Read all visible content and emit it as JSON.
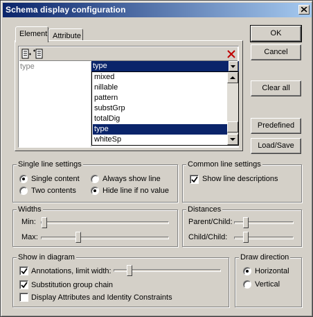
{
  "window": {
    "title": "Schema display configuration"
  },
  "tabs": [
    {
      "label": "Element"
    },
    {
      "label": "Attribute"
    }
  ],
  "list": {
    "row_label": "type",
    "combo_value": "type",
    "dropdown_items": [
      "mixed",
      "nillable",
      "pattern",
      "substGrp",
      "totalDig",
      "type",
      "whiteSp"
    ],
    "selected_item": "type"
  },
  "buttons": {
    "ok": "OK",
    "cancel": "Cancel",
    "clear_all": "Clear all",
    "predefined": "Predefined",
    "load_save": "Load/Save"
  },
  "single_line": {
    "title": "Single line settings",
    "single_content": "Single content",
    "two_contents": "Two contents",
    "always_show": "Always show line",
    "hide_line": "Hide line if no value",
    "selected": [
      "Single content",
      "Hide line if no value"
    ]
  },
  "common_line": {
    "title": "Common line settings",
    "show_desc": "Show line descriptions",
    "show_desc_checked": true
  },
  "widths": {
    "title": "Widths",
    "min": "Min:",
    "max": "Max:",
    "min_level": 0.0,
    "max_level": 0.24
  },
  "distances": {
    "title": "Distances",
    "parent_child": "Parent/Child:",
    "child_child": "Child/Child:",
    "parent_child_level": 0.2,
    "child_child_level": 0.2
  },
  "show_in_diagram": {
    "title": "Show in diagram",
    "annotations": "Annotations, limit width:",
    "annotations_checked": true,
    "annotations_level": 0.15,
    "subst_chain": "Substitution group chain",
    "subst_checked": true,
    "display_attr": "Display Attributes and Identity Constraints",
    "display_attr_checked": false
  },
  "draw_direction": {
    "title": "Draw direction",
    "horizontal": "Horizontal",
    "vertical": "Vertical",
    "selected": "Horizontal"
  }
}
